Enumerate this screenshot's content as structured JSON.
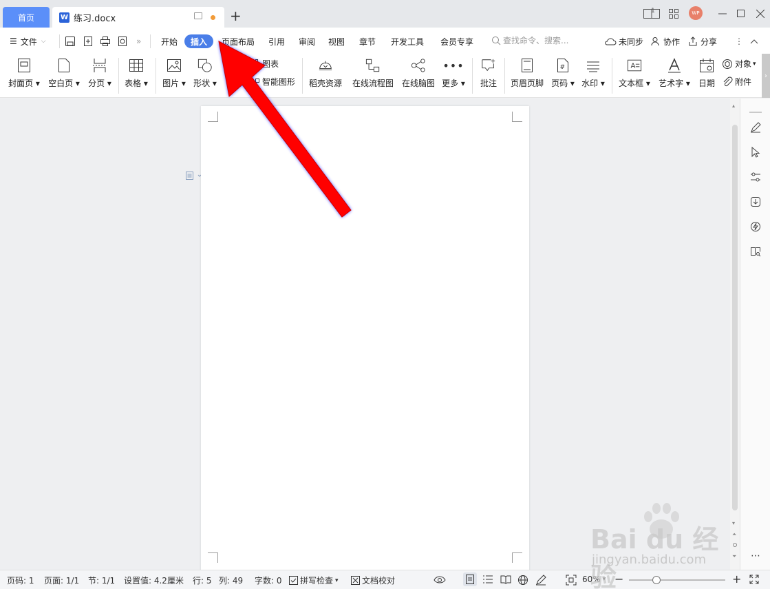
{
  "titlebar": {
    "home_tab": "首页",
    "doc_tab": "练习.docx",
    "doc_icon_letter": "W",
    "new_tab": "+",
    "avatar_text": "WP",
    "layout_badge": "1"
  },
  "menu": {
    "file": "文件",
    "tabs": [
      "开始",
      "插入",
      "页面布局",
      "引用",
      "审阅",
      "视图",
      "章节",
      "开发工具",
      "会员专享"
    ],
    "active_tab": "插入",
    "search_placeholder": "查找命令、搜索...",
    "sync": "未同步",
    "collab": "协作",
    "share": "分享"
  },
  "ribbon": {
    "cover": "封面页",
    "blank": "空白页",
    "page_break": "分页",
    "table": "表格",
    "picture": "图片",
    "shape": "形状",
    "chart": "图表",
    "smart_shape": "智能图形",
    "resources": "稻壳资源",
    "flowchart": "在线流程图",
    "mindmap": "在线脑图",
    "more": "更多",
    "comment": "批注",
    "header_footer": "页眉页脚",
    "page_number": "页码",
    "watermark": "水印",
    "textbox": "文本框",
    "wordart": "艺术字",
    "date": "日期",
    "object": "对象",
    "attachment": "附件"
  },
  "status": {
    "page": "页码: 1",
    "pages": "页面: 1/1",
    "section": "节: 1/1",
    "setting": "设置值: 4.2厘米",
    "row": "行: 5",
    "col": "列: 49",
    "words": "字数: 0",
    "spell": "拼写检查",
    "proof": "文档校对",
    "zoom": "60%"
  },
  "watermark": {
    "brand": "Bai du 经验",
    "url": "jingyan.baidu.com"
  },
  "colors": {
    "accent": "#4a7ee8",
    "home_tab": "#5b8ff9",
    "arrow": "#ff0000",
    "arrow_glow": "#1a1aff",
    "modified_dot": "#f29b38"
  }
}
